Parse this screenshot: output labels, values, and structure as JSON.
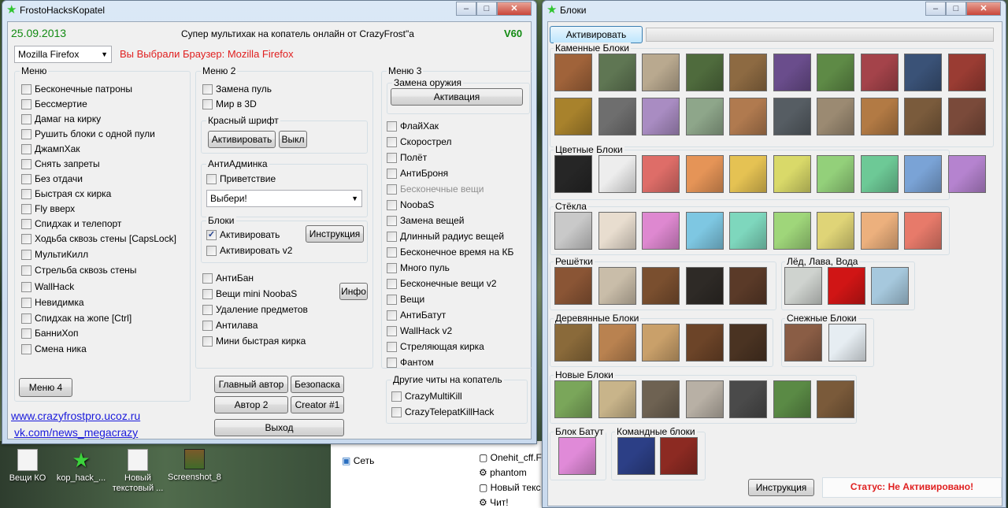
{
  "desktop": {
    "icons": [
      {
        "label": "Вещи КО",
        "kind": "doc"
      },
      {
        "label": "kop_hack_...",
        "kind": "star"
      },
      {
        "label": "Новый текстовый ...",
        "kind": "doc"
      },
      {
        "label": "Screenshot_8",
        "kind": "img"
      }
    ],
    "explorer": {
      "sidebar": "Сеть",
      "files": [
        "Onehit_cff.F",
        "phantom",
        "Новый текс",
        "Чит!"
      ]
    }
  },
  "main": {
    "title": "FrostoHacksKopatel",
    "date": "25.09.2013",
    "heading": "Супер мультихак на копатель онлайн от CrazyFrost\"а",
    "version": "V60",
    "browser_select": "Mozilla Firefox",
    "browser_msg": "Вы Выбрали Браузер: Mozilla Firefox",
    "menu1": {
      "label": "Меню",
      "items": [
        "Бесконечные патроны",
        "Бессмертие",
        "Дамаг на кирку",
        "Рушить блоки с одной пули",
        "ДжампХак",
        "Снять запреты",
        "Без отдачи",
        "Быстрая сх кирка",
        "Fly вверх",
        "Спидхак и телепорт",
        "Ходьба сквозь стены [CapsLock]",
        "МультиКилл",
        "Стрельба сквозь стены",
        "WallHack",
        "Невидимка",
        "Спидхак на жопе [Ctrl]",
        "БанниХоп",
        "Смена ника"
      ]
    },
    "menu2": {
      "label": "Меню 2",
      "items": [
        "Замена пуль",
        "Мир в 3D"
      ],
      "red_font": {
        "label": "Красный шрифт",
        "activate": "Активировать",
        "off": "Выкл"
      },
      "antiadmin": {
        "label": "АнтиАдминка",
        "greeting": "Приветствие",
        "select": "Выбери!"
      },
      "blocks": {
        "label": "Блоки",
        "activate": "Активировать",
        "activate_v2": "Активировать v2",
        "help": "Инструкция"
      },
      "extra": [
        "АнтиБан",
        "Вещи mini NoobaS",
        "Удаление предметов",
        "Антилава",
        "Мини быстрая кирка"
      ],
      "info": "Инфо"
    },
    "menu3": {
      "label": "Меню 3",
      "weapon": {
        "label": "Замена оружия",
        "button": "Активация"
      },
      "items": [
        "ФлайХак",
        "Скорострел",
        "Полёт",
        "АнтиБроня",
        "Бесконечные вещи",
        "NoobaS",
        "Замена вещей",
        "Длинный радиус вещей",
        "Бесконечное время на КБ",
        "Много пуль",
        "Бесконечные вещи v2",
        "Вещи",
        "АнтиБатут",
        "WallHack v2",
        "Стреляющая кирка",
        "Фантом"
      ],
      "disabled_index": 4,
      "other": {
        "label": "Другие читы на копатель",
        "items": [
          "CrazyMultiKill",
          "CrazyTelepatKillHack"
        ]
      }
    },
    "buttons": {
      "menu4": "Меню 4",
      "main_author": "Главный автор",
      "safety": "Безопаска",
      "author2": "Автор 2",
      "creator": "Creator #1",
      "exit": "Выход"
    },
    "links": [
      "www.crazyfrostpro.ucoz.ru",
      "vk.com/news_megacrazy"
    ]
  },
  "blocks": {
    "title": "Блоки",
    "activate": "Активировать",
    "help": "Инструкция",
    "status": "Статус: Не Активировано!",
    "sections": {
      "stone": "Каменные Блоки",
      "colored": "Цветные Блоки",
      "glass": "Стёкла",
      "grates": "Решётки",
      "ice": "Лёд, Лава, Вода",
      "wood": "Деревянные Блоки",
      "snow": "Снежные Блоки",
      "new": "Новые Блоки",
      "trampoline": "Блок Батут",
      "team": "Командные блоки"
    },
    "colors": {
      "stone": [
        "#a0633a",
        "#5f7653",
        "#b9a98f",
        "#4f6b3d",
        "#8d6a42",
        "#6a4d8c",
        "#5e8a46",
        "#a4434a",
        "#3a5277",
        "#9a3c33",
        "#a8822c",
        "#6e6e6e",
        "#a98cc2",
        "#8ea68a",
        "#b07a4f",
        "#565d63",
        "#9b8a72",
        "#b27a44",
        "#7a5b3c",
        "#7a4a3a"
      ],
      "colored": [
        "#262626",
        "#ededed",
        "#de6d68",
        "#e59457",
        "#e5c253",
        "#d9d969",
        "#93d07a",
        "#6dc996",
        "#7aa3d6",
        "#b583cf"
      ],
      "glass": [
        "#c9c9c9",
        "#e8ddcf",
        "#de88d0",
        "#7ec7e2",
        "#7ed7bd",
        "#9fd67a",
        "#dfd477",
        "#ecb07d",
        "#e77a6a"
      ],
      "grates": [
        "#8a5535",
        "#c9bda9",
        "#7a4f2f",
        "#2e2a26",
        "#5a3a28"
      ],
      "ice": [
        "#cfd3cf",
        "#d01515",
        "#a6c8dd"
      ],
      "wood": [
        "#8a6a3a",
        "#b98250",
        "#c9a06a",
        "#6c4428",
        "#4a3322"
      ],
      "snow": [
        "#8a5d45",
        "#e6edf2"
      ],
      "new": [
        "#7aa65a",
        "#c8b48a",
        "#6e6252",
        "#b8b0a5",
        "#4a4a4a",
        "#5a8a45",
        "#7a5a3a"
      ],
      "trampoline": [
        "#e08ad8"
      ],
      "team": [
        "#2c3f86",
        "#8c2a22"
      ]
    }
  }
}
